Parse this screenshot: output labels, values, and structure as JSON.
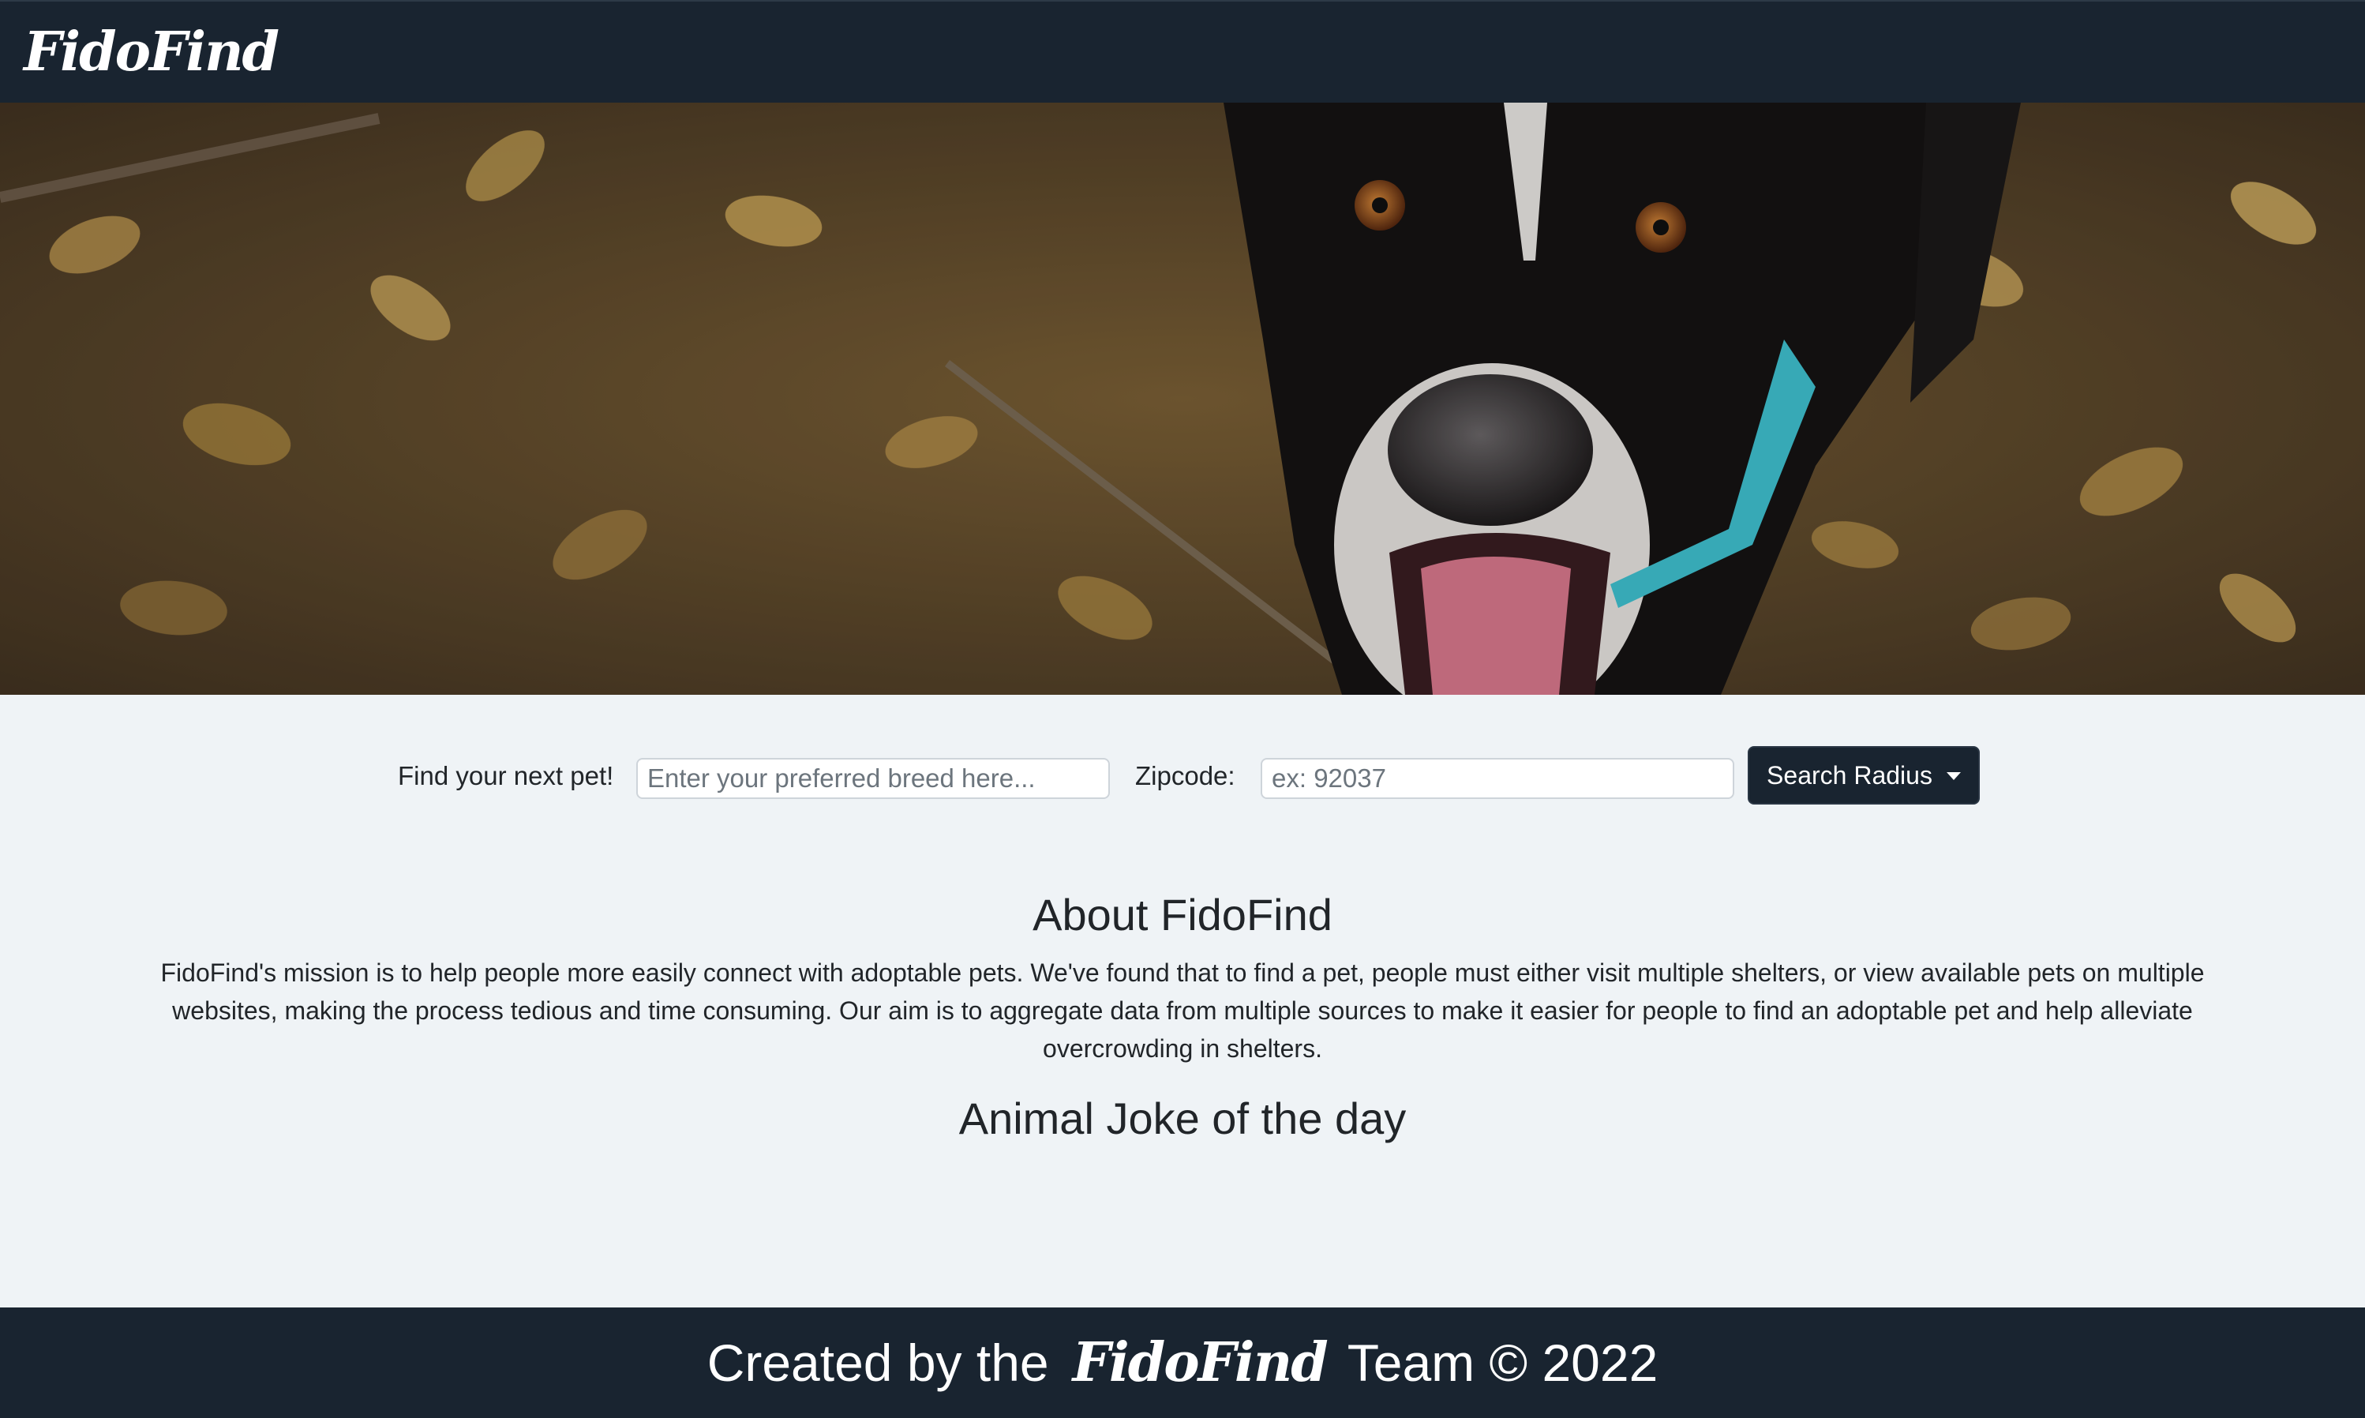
{
  "navbar": {
    "brand": "FidoFind"
  },
  "hero": {
    "image_desc": "dog-photo"
  },
  "search": {
    "label": "Find your next pet!",
    "breed_placeholder": "Enter your preferred breed here...",
    "zip_label": "Zipcode:",
    "zip_placeholder": "ex: 92037",
    "radius_button": "Search Radius"
  },
  "about": {
    "title": "About FidoFind",
    "text": "FidoFind's mission is to help people more easily connect with adoptable pets. We've found that to find a pet, people must either visit multiple shelters, or view available pets on multiple websites, making the process tedious and time consuming. Our aim is to aggregate data from multiple sources to make it easier for people to find an adoptable pet and help alleviate overcrowding in shelters."
  },
  "joke": {
    "title": "Animal Joke of the day"
  },
  "footer": {
    "prefix": "Created by the",
    "brand": "FidoFind",
    "suffix": "Team © 2022"
  },
  "colors": {
    "navbar_bg": "#192430",
    "page_bg": "#eff3f6",
    "collar": "#3fc1d0"
  }
}
